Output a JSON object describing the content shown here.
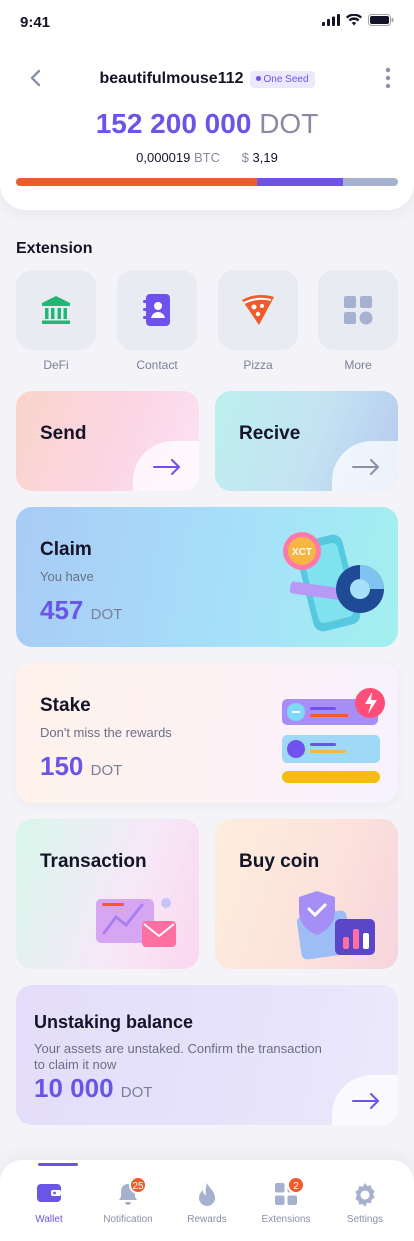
{
  "status": {
    "time": "9:41"
  },
  "header": {
    "username": "beautifulmouse112",
    "seed_badge": "One Seed",
    "balance_amount": "152 200 000",
    "balance_unit": "DOT",
    "btc_amount": "0,000019",
    "btc_unit": "BTC",
    "usd_symbol": "$",
    "usd_amount": "3,19",
    "allocation": [
      0.63,
      0.225,
      0.145
    ],
    "colors": {
      "accent": "#6a56e6",
      "orange": "#f2592b",
      "grey": "#a6b1cf"
    }
  },
  "extension": {
    "title": "Extension",
    "items": [
      {
        "label": "DeFi",
        "icon": "bank-icon"
      },
      {
        "label": "Contact",
        "icon": "contact-book-icon"
      },
      {
        "label": "Pizza",
        "icon": "pizza-icon"
      },
      {
        "label": "More",
        "icon": "grid-more-icon"
      }
    ]
  },
  "cards": {
    "send": {
      "title": "Send"
    },
    "recive": {
      "title": "Recive"
    },
    "claim": {
      "title": "Claim",
      "subtitle": "You have",
      "amount": "457",
      "unit": "DOT",
      "badge": "XCT"
    },
    "stake": {
      "title": "Stake",
      "subtitle": "Don't miss the rewards",
      "amount": "150",
      "unit": "DOT"
    },
    "transaction": {
      "title": "Transaction"
    },
    "buy": {
      "title": "Buy coin"
    },
    "unstake": {
      "title": "Unstaking balance",
      "line1": "Your assets are unstaked. Confirm the transaction",
      "line2": "to claim it now",
      "amount": "10 000",
      "unit": "DOT"
    }
  },
  "nav": {
    "items": [
      {
        "label": "Wallet",
        "icon": "wallet-icon",
        "active": true
      },
      {
        "label": "Notification",
        "icon": "bell-icon",
        "badge": "25"
      },
      {
        "label": "Rewards",
        "icon": "flame-icon"
      },
      {
        "label": "Extensions",
        "icon": "apps-icon",
        "badge": "2"
      },
      {
        "label": "Settings",
        "icon": "gear-icon"
      }
    ]
  }
}
